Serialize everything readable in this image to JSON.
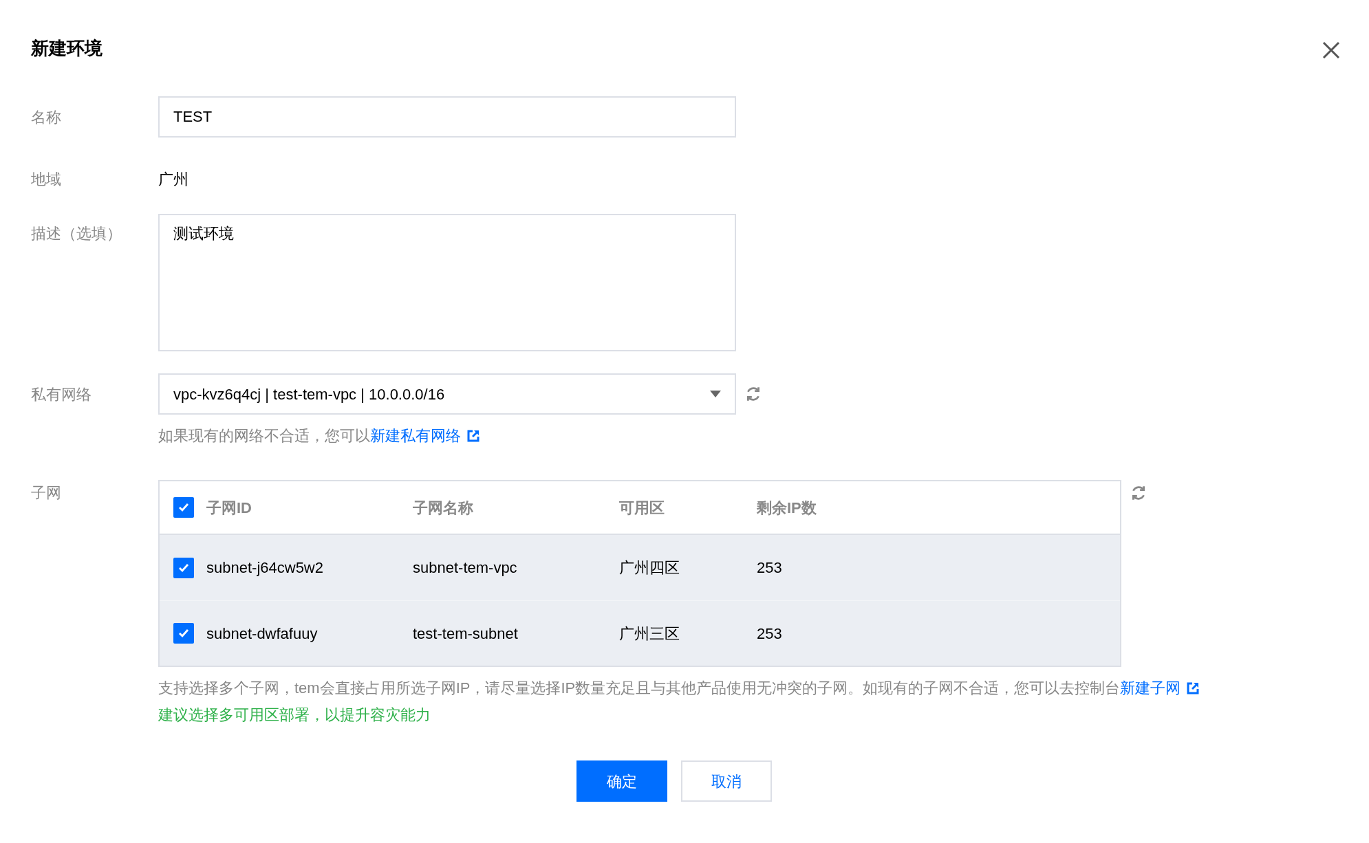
{
  "dialog": {
    "title": "新建环境"
  },
  "form": {
    "name": {
      "label": "名称",
      "value": "TEST"
    },
    "region": {
      "label": "地域",
      "value": "广州"
    },
    "description": {
      "label": "描述（选填）",
      "value": "测试环境"
    },
    "vpc": {
      "label": "私有网络",
      "value": "vpc-kvz6q4cj | test-tem-vpc | 10.0.0.0/16",
      "hint": "如果现有的网络不合适，您可以",
      "link": "新建私有网络"
    },
    "subnet": {
      "label": "子网",
      "table": {
        "all_checked": true,
        "columns": [
          "子网ID",
          "子网名称",
          "可用区",
          "剩余IP数"
        ],
        "rows": [
          {
            "checked": true,
            "cells": [
              "subnet-j64cw5w2",
              "subnet-tem-vpc",
              "广州四区",
              "253"
            ]
          },
          {
            "checked": true,
            "cells": [
              "subnet-dwfafuuy",
              "test-tem-subnet",
              "广州三区",
              "253"
            ]
          }
        ]
      },
      "hint": "支持选择多个子网，tem会直接占用所选子网IP，请尽量选择IP数量充足且与其他产品使用无冲突的子网。如现有的子网不合适，您可以去控制台",
      "link": "新建子网",
      "tip": "建议选择多可用区部署，以提升容灾能力"
    }
  },
  "buttons": [
    {
      "label": "确定",
      "kind": "primary"
    },
    {
      "label": "取消",
      "kind": "secondary"
    }
  ]
}
